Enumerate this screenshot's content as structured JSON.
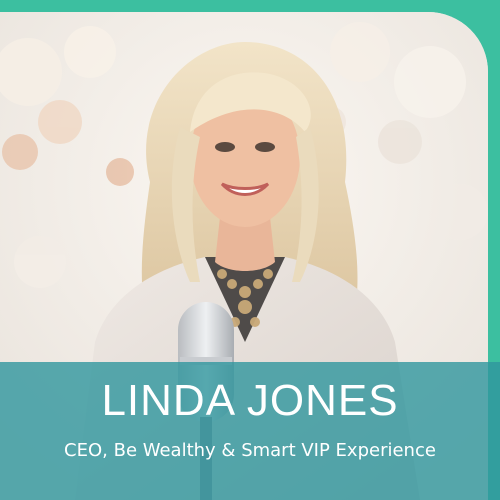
{
  "profile": {
    "name": "LINDA JONES",
    "title": "CEO, Be Wealthy & Smart VIP Experience"
  },
  "photo": {
    "subject": "portrait-woman-with-microphone"
  },
  "colors": {
    "accent": "#3cbfa0",
    "caption_band": "#2f969e",
    "caption_text": "#ffffff"
  }
}
